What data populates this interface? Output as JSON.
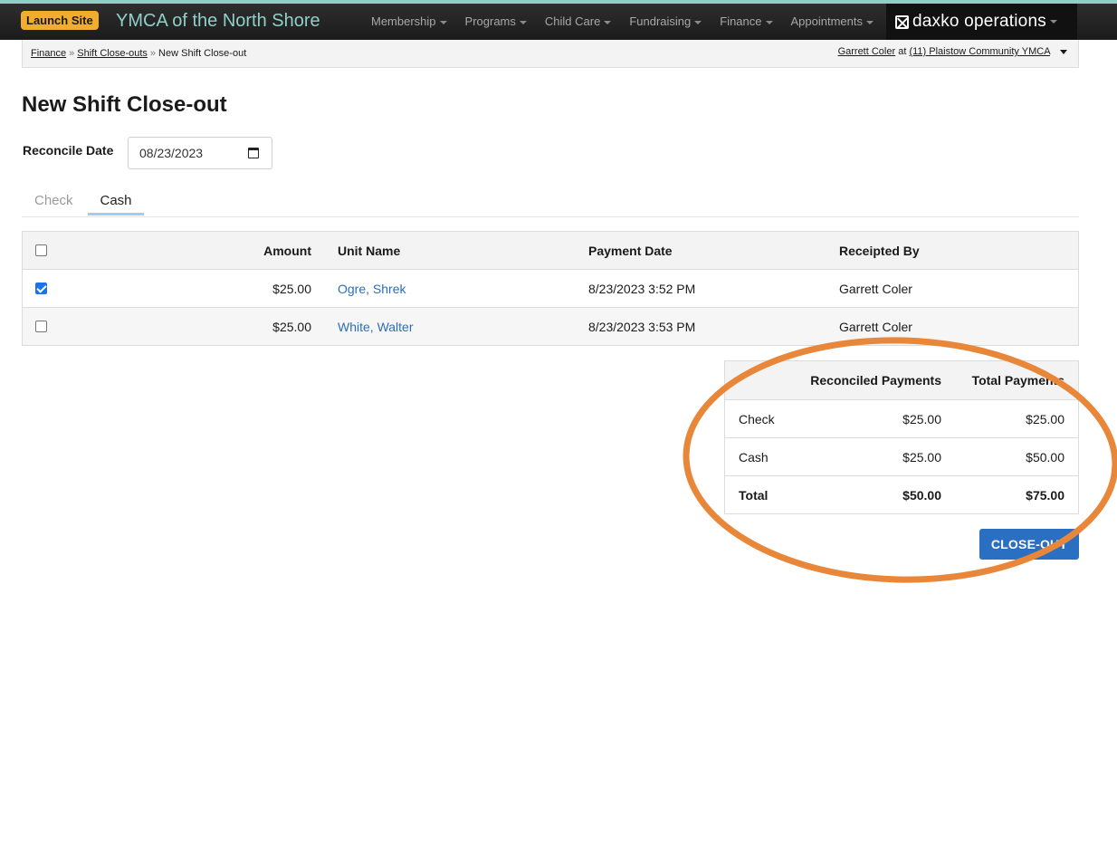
{
  "nav": {
    "launch_site": "Launch Site",
    "site_title": "YMCA of the North Shore",
    "items": [
      {
        "label": "Membership"
      },
      {
        "label": "Programs"
      },
      {
        "label": "Child Care"
      },
      {
        "label": "Fundraising"
      },
      {
        "label": "Finance"
      },
      {
        "label": "Appointments"
      }
    ],
    "brand": "daxko operations"
  },
  "breadcrumb": {
    "items": [
      "Finance",
      "Shift Close-outs"
    ],
    "current": "New Shift Close-out",
    "user": "Garrett Coler",
    "at": "at",
    "location": "(11) Plaistow Community YMCA"
  },
  "page": {
    "title": "New Shift Close-out",
    "reconcile_label": "Reconcile Date",
    "reconcile_value": "08/23/2023"
  },
  "tabs": [
    {
      "label": "Check",
      "active": false
    },
    {
      "label": "Cash",
      "active": true
    }
  ],
  "payments": {
    "headers": {
      "amount": "Amount",
      "unit": "Unit Name",
      "date": "Payment Date",
      "receipted": "Receipted By"
    },
    "rows": [
      {
        "checked": true,
        "amount": "$25.00",
        "unit": "Ogre, Shrek",
        "date": "8/23/2023 3:52 PM",
        "receipted": "Garrett Coler"
      },
      {
        "checked": false,
        "amount": "$25.00",
        "unit": "White, Walter",
        "date": "8/23/2023 3:53 PM",
        "receipted": "Garrett Coler"
      }
    ]
  },
  "summary": {
    "headers": {
      "reconciled": "Reconciled Payments",
      "total": "Total Payments"
    },
    "rows": [
      {
        "label": "Check",
        "reconciled": "$25.00",
        "total": "$25.00"
      },
      {
        "label": "Cash",
        "reconciled": "$25.00",
        "total": "$50.00"
      }
    ],
    "total": {
      "label": "Total",
      "reconciled": "$50.00",
      "total": "$75.00"
    }
  },
  "actions": {
    "closeout": "CLOSE-OUT"
  },
  "colors": {
    "annotation": "#e8873a",
    "accent": "#2b6fc2",
    "launch": "#f0ad2e"
  }
}
